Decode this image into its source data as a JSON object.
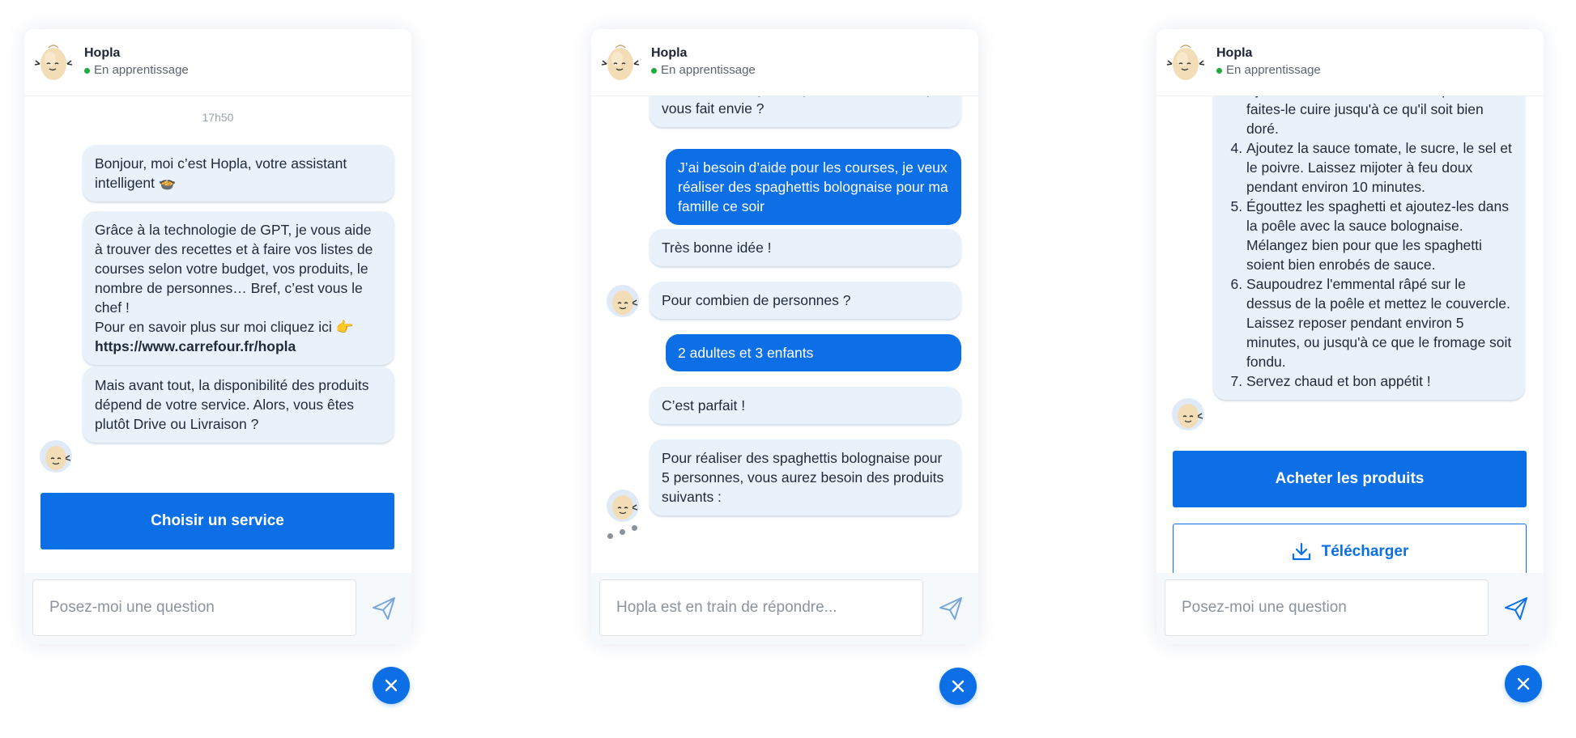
{
  "colors": {
    "accent": "#0d6fe6",
    "bot_bubble": "#e9f1fb",
    "status_online": "#1faa3b"
  },
  "panels": [
    {
      "header": {
        "name": "Hopla",
        "status": "En apprentissage"
      },
      "time": "17h50",
      "messages": [
        "Bonjour, moi c’est Hopla, votre assistant intelligent 🍲",
        "Grâce à la technologie de GPT, je vous aide à trouver des recettes et à faire vos listes de courses selon votre budget, vos produits, le nombre de personnes… Bref, c’est vous le chef !",
        "Pour en savoir plus sur moi cliquez ici 👉",
        "https://www.carrefour.fr/hopla",
        "Mais avant tout, la disponibilité des produits dépend de votre service. Alors, vous êtes plutôt Drive ou Livraison ?"
      ],
      "button": "Choisir un service",
      "input_placeholder": "Posez-moi une question"
    },
    {
      "header": {
        "name": "Hopla",
        "status": "En apprentissage"
      },
      "messages": [
        "Cette fois c’est je suis prêt ! Dites-moi ce qui vous fait envie ?",
        "J’ai besoin d’aide pour les courses, je veux réaliser des spaghettis bolognaise pour ma famille ce soir",
        "Très bonne idée !",
        "Pour combien de personnes ?",
        "2 adultes et 3 enfants",
        "C’est parfait !",
        "Pour réaliser des spaghettis bolognaise pour 5 personnes, vous aurez besoin des produits suivants :"
      ],
      "input_placeholder": "Hopla est en train de répondre..."
    },
    {
      "header": {
        "name": "Hopla",
        "status": "En apprentissage"
      },
      "steps_cut": "Ajoutez le bœuf haché dans la poêle et faites-le cuire jusqu'à ce qu'il soit bien doré.",
      "steps": [
        "Ajoutez la sauce tomate, le sucre, le sel et le poivre. Laissez mijoter à feu doux pendant environ 10 minutes.",
        "Égouttez les spaghetti et ajoutez-les dans la poêle avec la sauce bolognaise. Mélangez bien pour que les spaghetti soient bien enrobés de sauce.",
        "Saupoudrez l'emmental râpé sur le dessus de la poêle et mettez le couvercle. Laissez reposer pendant environ 5 minutes, ou jusqu'à ce que le fromage soit fondu.",
        "Servez chaud et bon appétit !"
      ],
      "button_primary": "Acheter les produits",
      "button_secondary": "Télécharger",
      "input_placeholder": "Posez-moi une question"
    }
  ]
}
